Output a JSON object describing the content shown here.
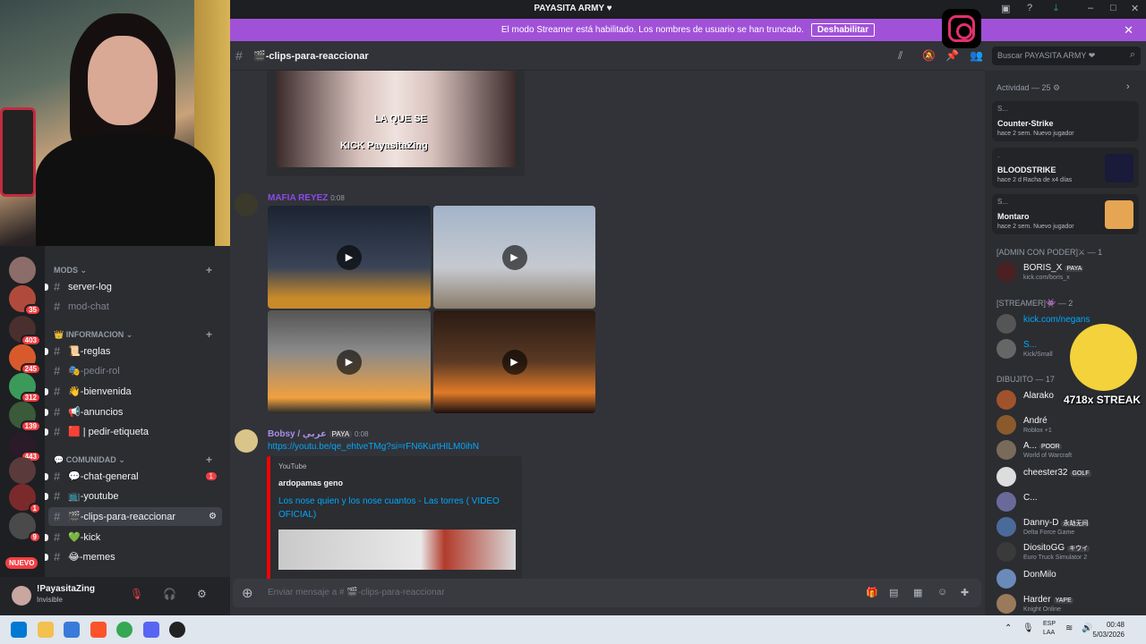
{
  "window": {
    "title": "PAYASITA ARMY",
    "title_icon": "heart-icon"
  },
  "banner": {
    "text": "El modo Streamer está habilitado. Los nombres de usuario se han truncado.",
    "button": "Deshabilitar"
  },
  "server_badges": [
    "35",
    "403",
    "245",
    "312",
    "139",
    "443",
    "1",
    "9"
  ],
  "nuevo_label": "NUEVO",
  "channels": {
    "categories": {
      "mods": "MODS",
      "informacion": "INFORMACION",
      "comunidad": "COMUNIDAD"
    },
    "mods": [
      {
        "name": "server-log",
        "muted": false
      },
      {
        "name": "mod-chat",
        "muted": true
      }
    ],
    "info": [
      {
        "name": "📜-reglas",
        "muted": false
      },
      {
        "name": "🎭-pedir-rol",
        "muted": true
      },
      {
        "name": "👋-bienvenida",
        "muted": false
      },
      {
        "name": "📢-anuncios",
        "muted": false
      },
      {
        "name": "🟥 | pedir-etiqueta",
        "muted": false
      }
    ],
    "comunidad": [
      {
        "name": "💬-chat-general",
        "muted": false,
        "badge": "1"
      },
      {
        "name": "📺-youtube",
        "muted": false
      },
      {
        "name": "🎬-clips-para-reaccionar",
        "muted": false,
        "active": true
      },
      {
        "name": "💚-kick",
        "muted": false
      },
      {
        "name": "😂-memes",
        "muted": false
      }
    ]
  },
  "user": {
    "name": "!PayasitaZing",
    "status": "Invisible"
  },
  "header": {
    "channel": "🎬-clips-para-reaccionar",
    "search_placeholder": "Buscar PAYASITA ARMY ❤"
  },
  "messages": [
    {
      "clip_caption_1": "LA QUE SE",
      "clip_caption_2": "KICK PayasitaZing"
    },
    {
      "author": "MAFIA REYEZ",
      "time": "0:08",
      "videos": 4
    },
    {
      "author": "Bobsy / عربي",
      "tag": "PAYA",
      "time": "0:08",
      "link": "https://youtu.be/qe_ehtveTMg?si=rFN6KurtHILM0ihN",
      "embed_provider": "YouTube",
      "embed_author": "ardopamas geno",
      "embed_title": "Los nose quien y los nose cuantos - Las torres ( VIDEO OFICIAL)"
    }
  ],
  "composer": {
    "placeholder": "Enviar mensaje a # 🎬-clips-para-reaccionar"
  },
  "members": {
    "activity_header": "Actividad — 25",
    "activities": [
      {
        "member": "S...",
        "game": "Counter-Strike",
        "sub": "hace 2 sem.   Nuevo jugador"
      },
      {
        "member": ".",
        "game": "BLOODSTRIKE",
        "sub": "hace 2 d   Racha de x4 días"
      },
      {
        "member": "S...",
        "game": "Montaro",
        "sub": "hace 2 sem.   Nuevo jugador"
      }
    ],
    "groups": [
      {
        "label": "[ADMIN CON PODER]⚔ — 1"
      },
      {
        "label": "[STREAMER]👾 — 2"
      },
      {
        "label": "DIBUJITO — 17"
      }
    ],
    "admin": [
      {
        "name": "BORIS_X",
        "tag": "PAYA",
        "sub": "kick.com/boris_x"
      }
    ],
    "streamers": [
      {
        "name": "kick.com/negans",
        "sub": ""
      },
      {
        "name": "S...",
        "sub": "Kick/Small"
      }
    ],
    "dibujito": [
      {
        "name": "Alarako",
        "tag": "",
        "sub": ""
      },
      {
        "name": "André",
        "tag": "",
        "sub": "Roblox +1"
      },
      {
        "name": "A...",
        "tag": "POOR",
        "sub": "World of Warcraft"
      },
      {
        "name": "cheester32",
        "tag": "GOLF",
        "sub": ""
      },
      {
        "name": "C...",
        "tag": "",
        "sub": ""
      },
      {
        "name": "Danny-D",
        "tag": "永劫无间",
        "sub": "Delta Force Game"
      },
      {
        "name": "DiositoGG",
        "tag": "キウイ",
        "sub": "Euro Truck Simulator 2"
      },
      {
        "name": "DonMilo",
        "tag": "",
        "sub": ""
      },
      {
        "name": "Harder",
        "tag": "YAPE",
        "sub": "Knight Online"
      }
    ]
  },
  "overlay": {
    "streak": "4718x STREAK"
  },
  "taskbar": {
    "lang_1": "ESP",
    "lang_2": "LAA",
    "time": "00:48",
    "date": "5/03/2026"
  },
  "colors": {
    "banner": "#a151d8",
    "bg_chat": "#313338",
    "bg_sidebar": "#2b2d31",
    "link": "#00a8fc",
    "mafia_name": "#8a4be7",
    "bobsy_name": "#a98ee8"
  }
}
